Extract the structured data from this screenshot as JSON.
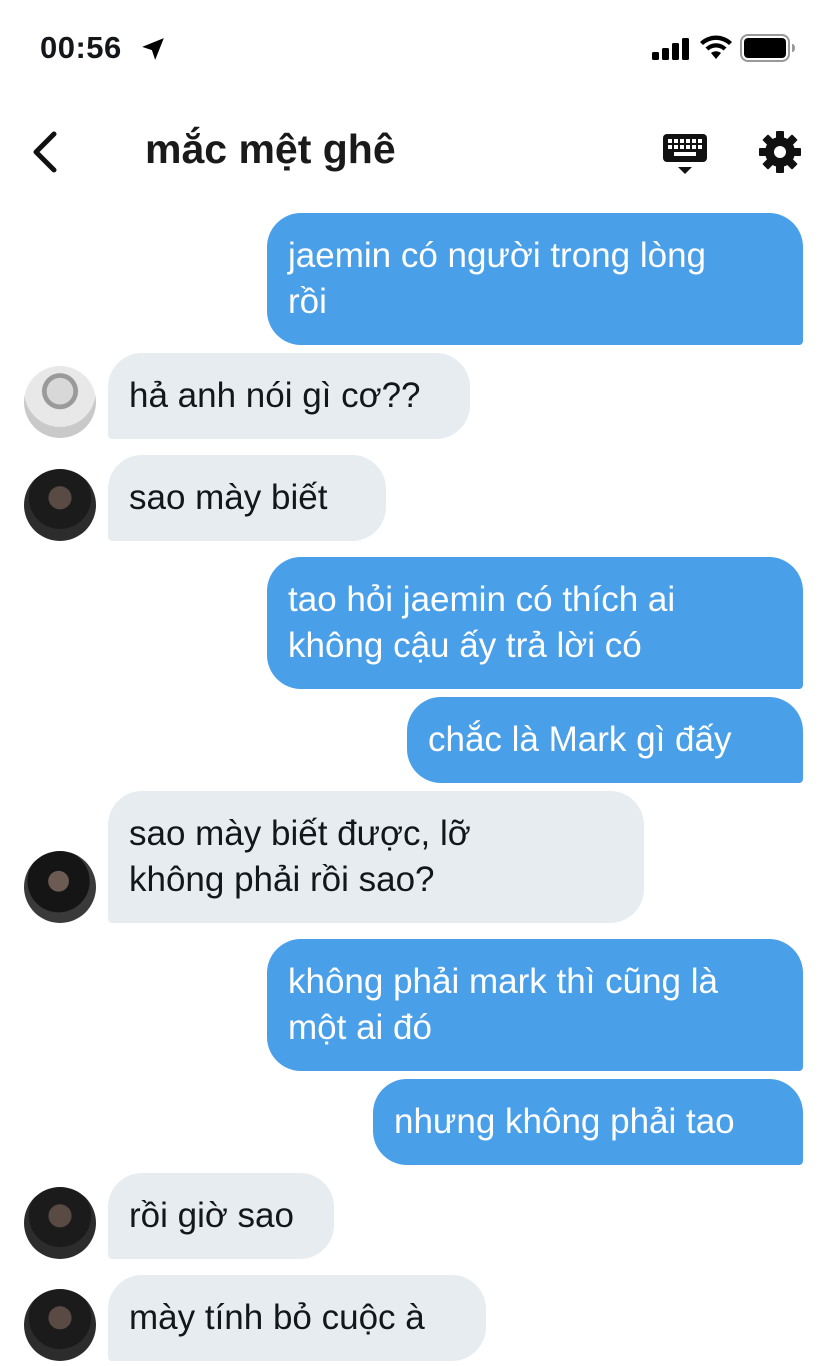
{
  "status_bar": {
    "time": "00:56",
    "icons": [
      "location-arrow-icon",
      "cellular-signal-icon",
      "wifi-icon",
      "battery-icon"
    ]
  },
  "header": {
    "title": "mắc mệt ghê",
    "icons": [
      "back-chevron-icon",
      "keyboard-icon",
      "gear-icon"
    ]
  },
  "colors": {
    "outgoing_bubble": "#4a9fe9",
    "incoming_bubble": "#e6ecf0",
    "outgoing_text": "#ffffff",
    "incoming_text": "#14171a"
  },
  "messages": [
    {
      "direction": "out",
      "text": "jaemin có người trong lòng\nrồi"
    },
    {
      "direction": "in",
      "text": "hả anh nói gì cơ??"
    },
    {
      "direction": "in",
      "text": "sao mày biết"
    },
    {
      "direction": "out",
      "text": "tao hỏi jaemin có thích ai\nkhông cậu ấy trả lời có"
    },
    {
      "direction": "out",
      "text": "chắc là Mark gì đấy"
    },
    {
      "direction": "in",
      "text": "sao mày biết được, lỡ\nkhông phải rồi sao?"
    },
    {
      "direction": "out",
      "text": "không phải mark thì cũng là\nmột ai đó"
    },
    {
      "direction": "out",
      "text": "nhưng không phải tao"
    },
    {
      "direction": "in",
      "text": "rồi giờ sao"
    },
    {
      "direction": "in",
      "text": "mày tính bỏ cuộc à"
    }
  ]
}
